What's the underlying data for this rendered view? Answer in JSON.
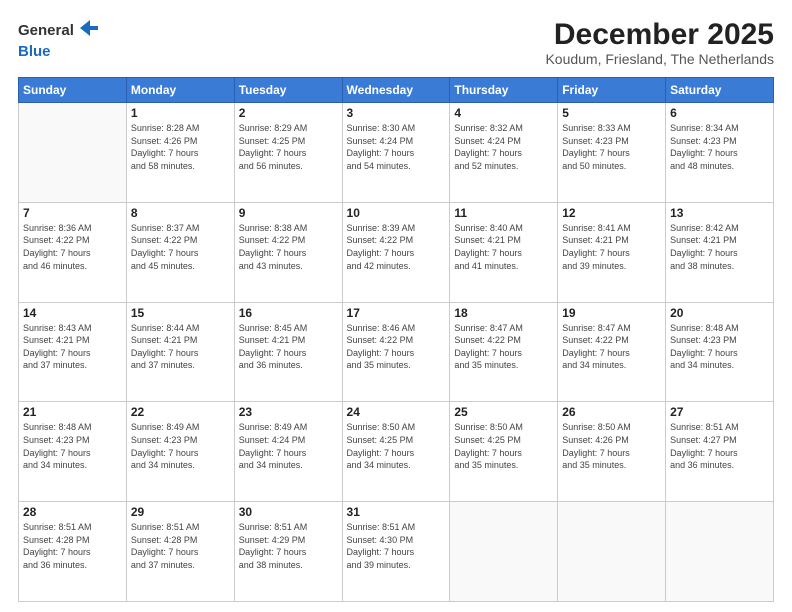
{
  "header": {
    "logo_general": "General",
    "logo_blue": "Blue",
    "title": "December 2025",
    "subtitle": "Koudum, Friesland, The Netherlands"
  },
  "calendar": {
    "days_of_week": [
      "Sunday",
      "Monday",
      "Tuesday",
      "Wednesday",
      "Thursday",
      "Friday",
      "Saturday"
    ],
    "weeks": [
      [
        {
          "day": "",
          "info": ""
        },
        {
          "day": "1",
          "info": "Sunrise: 8:28 AM\nSunset: 4:26 PM\nDaylight: 7 hours\nand 58 minutes."
        },
        {
          "day": "2",
          "info": "Sunrise: 8:29 AM\nSunset: 4:25 PM\nDaylight: 7 hours\nand 56 minutes."
        },
        {
          "day": "3",
          "info": "Sunrise: 8:30 AM\nSunset: 4:24 PM\nDaylight: 7 hours\nand 54 minutes."
        },
        {
          "day": "4",
          "info": "Sunrise: 8:32 AM\nSunset: 4:24 PM\nDaylight: 7 hours\nand 52 minutes."
        },
        {
          "day": "5",
          "info": "Sunrise: 8:33 AM\nSunset: 4:23 PM\nDaylight: 7 hours\nand 50 minutes."
        },
        {
          "day": "6",
          "info": "Sunrise: 8:34 AM\nSunset: 4:23 PM\nDaylight: 7 hours\nand 48 minutes."
        }
      ],
      [
        {
          "day": "7",
          "info": "Sunrise: 8:36 AM\nSunset: 4:22 PM\nDaylight: 7 hours\nand 46 minutes."
        },
        {
          "day": "8",
          "info": "Sunrise: 8:37 AM\nSunset: 4:22 PM\nDaylight: 7 hours\nand 45 minutes."
        },
        {
          "day": "9",
          "info": "Sunrise: 8:38 AM\nSunset: 4:22 PM\nDaylight: 7 hours\nand 43 minutes."
        },
        {
          "day": "10",
          "info": "Sunrise: 8:39 AM\nSunset: 4:22 PM\nDaylight: 7 hours\nand 42 minutes."
        },
        {
          "day": "11",
          "info": "Sunrise: 8:40 AM\nSunset: 4:21 PM\nDaylight: 7 hours\nand 41 minutes."
        },
        {
          "day": "12",
          "info": "Sunrise: 8:41 AM\nSunset: 4:21 PM\nDaylight: 7 hours\nand 39 minutes."
        },
        {
          "day": "13",
          "info": "Sunrise: 8:42 AM\nSunset: 4:21 PM\nDaylight: 7 hours\nand 38 minutes."
        }
      ],
      [
        {
          "day": "14",
          "info": "Sunrise: 8:43 AM\nSunset: 4:21 PM\nDaylight: 7 hours\nand 37 minutes."
        },
        {
          "day": "15",
          "info": "Sunrise: 8:44 AM\nSunset: 4:21 PM\nDaylight: 7 hours\nand 37 minutes."
        },
        {
          "day": "16",
          "info": "Sunrise: 8:45 AM\nSunset: 4:21 PM\nDaylight: 7 hours\nand 36 minutes."
        },
        {
          "day": "17",
          "info": "Sunrise: 8:46 AM\nSunset: 4:22 PM\nDaylight: 7 hours\nand 35 minutes."
        },
        {
          "day": "18",
          "info": "Sunrise: 8:47 AM\nSunset: 4:22 PM\nDaylight: 7 hours\nand 35 minutes."
        },
        {
          "day": "19",
          "info": "Sunrise: 8:47 AM\nSunset: 4:22 PM\nDaylight: 7 hours\nand 34 minutes."
        },
        {
          "day": "20",
          "info": "Sunrise: 8:48 AM\nSunset: 4:23 PM\nDaylight: 7 hours\nand 34 minutes."
        }
      ],
      [
        {
          "day": "21",
          "info": "Sunrise: 8:48 AM\nSunset: 4:23 PM\nDaylight: 7 hours\nand 34 minutes."
        },
        {
          "day": "22",
          "info": "Sunrise: 8:49 AM\nSunset: 4:23 PM\nDaylight: 7 hours\nand 34 minutes."
        },
        {
          "day": "23",
          "info": "Sunrise: 8:49 AM\nSunset: 4:24 PM\nDaylight: 7 hours\nand 34 minutes."
        },
        {
          "day": "24",
          "info": "Sunrise: 8:50 AM\nSunset: 4:25 PM\nDaylight: 7 hours\nand 34 minutes."
        },
        {
          "day": "25",
          "info": "Sunrise: 8:50 AM\nSunset: 4:25 PM\nDaylight: 7 hours\nand 35 minutes."
        },
        {
          "day": "26",
          "info": "Sunrise: 8:50 AM\nSunset: 4:26 PM\nDaylight: 7 hours\nand 35 minutes."
        },
        {
          "day": "27",
          "info": "Sunrise: 8:51 AM\nSunset: 4:27 PM\nDaylight: 7 hours\nand 36 minutes."
        }
      ],
      [
        {
          "day": "28",
          "info": "Sunrise: 8:51 AM\nSunset: 4:28 PM\nDaylight: 7 hours\nand 36 minutes."
        },
        {
          "day": "29",
          "info": "Sunrise: 8:51 AM\nSunset: 4:28 PM\nDaylight: 7 hours\nand 37 minutes."
        },
        {
          "day": "30",
          "info": "Sunrise: 8:51 AM\nSunset: 4:29 PM\nDaylight: 7 hours\nand 38 minutes."
        },
        {
          "day": "31",
          "info": "Sunrise: 8:51 AM\nSunset: 4:30 PM\nDaylight: 7 hours\nand 39 minutes."
        },
        {
          "day": "",
          "info": ""
        },
        {
          "day": "",
          "info": ""
        },
        {
          "day": "",
          "info": ""
        }
      ]
    ]
  }
}
